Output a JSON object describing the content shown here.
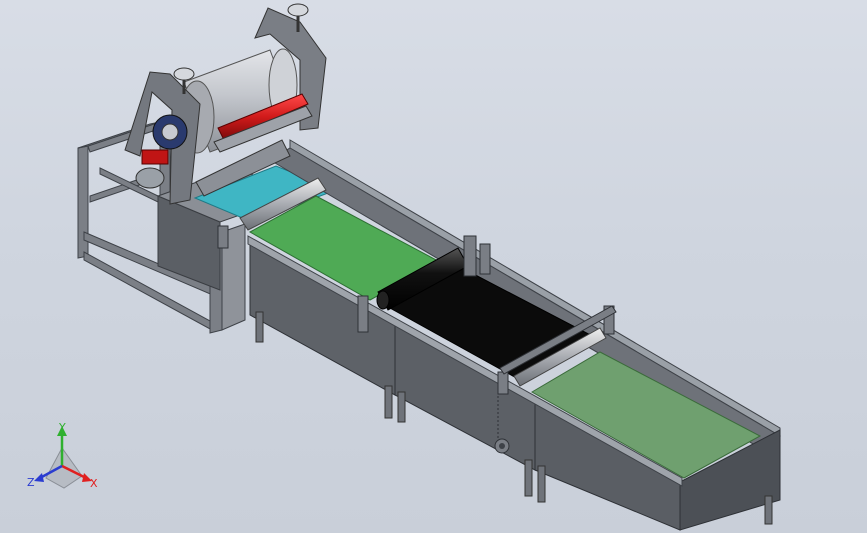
{
  "triad": {
    "y_label": "Y",
    "x_label": "X",
    "z_label": "Z",
    "colors": {
      "y": "#2fb02f",
      "x": "#e02020",
      "z": "#2a3cd0"
    }
  },
  "palette": {
    "frame": "#6f737a",
    "frame_dark": "#3e4248",
    "trough_side": "#5f6369",
    "trough_top": "#8a8e94",
    "belt_cyan": "#3fb6c4",
    "belt_green": "#4faa55",
    "belt_black": "#0b0b0b",
    "belt_light_green": "#6fa06f",
    "roller_red": "#d01a1a",
    "drum": "#b9bcc3"
  }
}
